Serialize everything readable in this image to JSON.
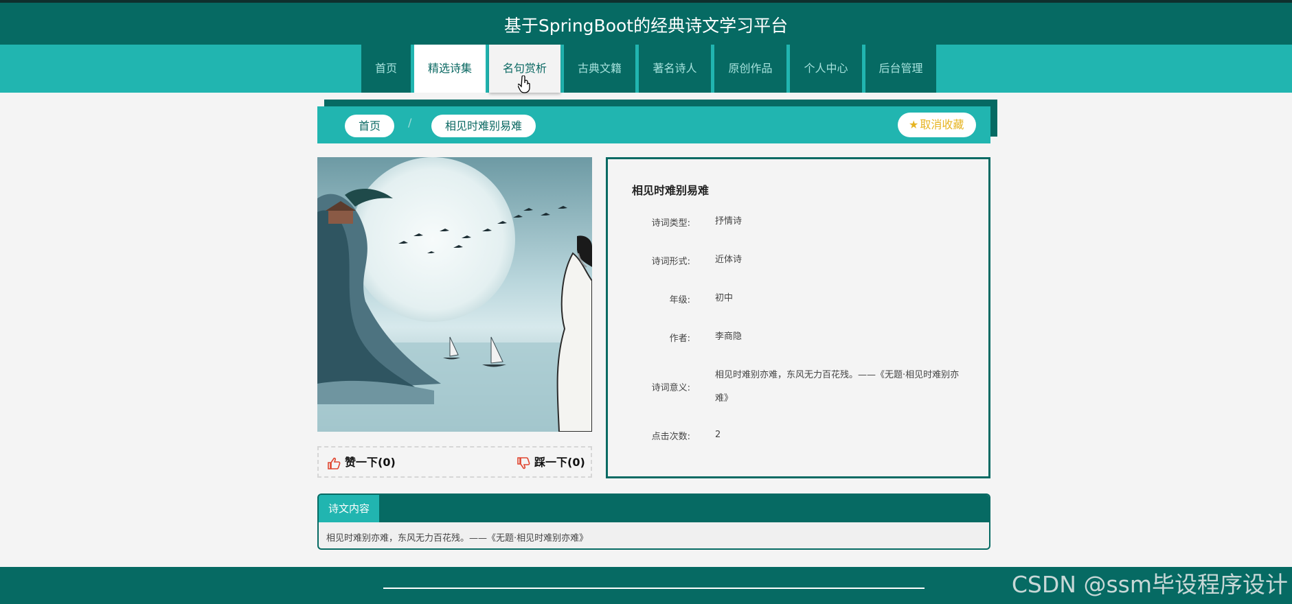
{
  "site": {
    "title": "基于SpringBoot的经典诗文学习平台"
  },
  "nav": {
    "items": [
      {
        "label": "首页",
        "state": "normal"
      },
      {
        "label": "精选诗集",
        "state": "active"
      },
      {
        "label": "名句赏析",
        "state": "hover"
      },
      {
        "label": "古典文籍",
        "state": "normal"
      },
      {
        "label": "著名诗人",
        "state": "normal"
      },
      {
        "label": "原创作品",
        "state": "normal"
      },
      {
        "label": "个人中心",
        "state": "normal"
      },
      {
        "label": "后台管理",
        "state": "normal"
      }
    ]
  },
  "breadcrumb": {
    "home": "首页",
    "separator": "/",
    "current": "相见时难别易难"
  },
  "favorite": {
    "icon": "star-icon",
    "label": "取消收藏"
  },
  "votes": {
    "like": {
      "icon": "thumbs-up-icon",
      "label": "赞一下(0)"
    },
    "dislike": {
      "icon": "thumbs-down-icon",
      "label": "踩一下(0)"
    }
  },
  "detail": {
    "title": "相见时难别易难",
    "fields": [
      {
        "label": "诗词类型:",
        "value": "抒情诗"
      },
      {
        "label": "诗词形式:",
        "value": "近体诗"
      },
      {
        "label": "年级:",
        "value": "初中"
      },
      {
        "label": "作者:",
        "value": "李商隐"
      },
      {
        "label": "诗词意义:",
        "value": "相见时难别亦难，东风无力百花残。——《无题·相见时难别亦难》"
      },
      {
        "label": "点击次数:",
        "value": "2"
      }
    ]
  },
  "content": {
    "tab": "诗文内容",
    "text": "相见时难别亦难，东风无力百花残。——《无题·相见时难别亦难》"
  },
  "watermark": "CSDN @ssm毕设程序设计",
  "colors": {
    "primary": "#066a63",
    "accent": "#21b5b0",
    "favorite": "#e6b422",
    "vote_icon": "#e0452f"
  }
}
